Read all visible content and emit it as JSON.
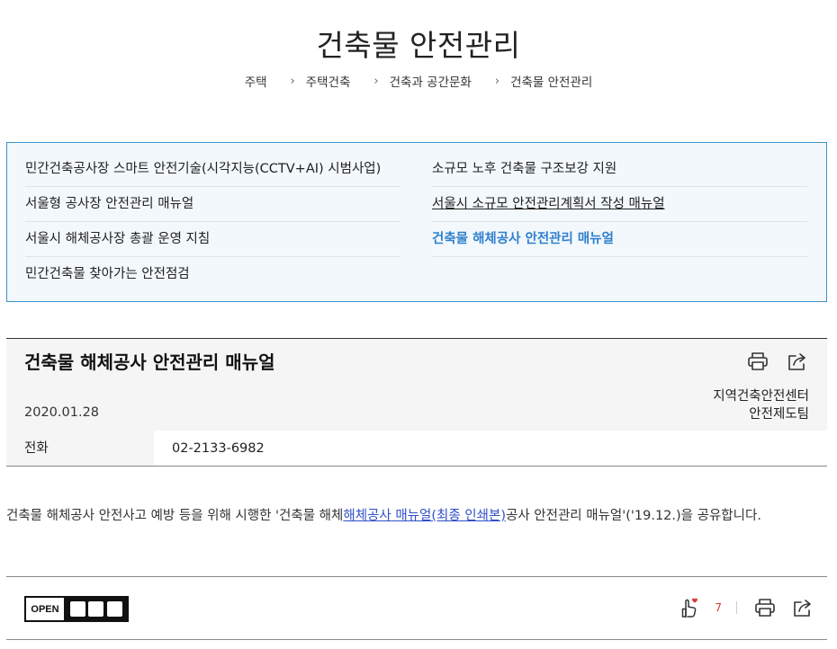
{
  "page": {
    "title": "건축물 안전관리"
  },
  "breadcrumb": [
    "주택",
    "주택건축",
    "건축과 공간문화",
    "건축물 안전관리"
  ],
  "related": {
    "left": [
      "민간건축공사장 스마트 안전기술(시각지능(CCTV+AI) 시범사업)",
      "서울형 공사장 안전관리 매뉴얼",
      "서울시 해체공사장 총괄 운영 지침",
      "민간건축물 찾아가는 안전점검"
    ],
    "right": [
      "소규모 노후 건축물 구조보강 지원",
      "서울시 소규모 안전관리계획서 작성 매뉴얼",
      "건축물 해체공사 안전관리 매뉴얼"
    ]
  },
  "article": {
    "title": "건축물 해체공사 안전관리 매뉴얼",
    "date": "2020.01.28",
    "dept_line1": "지역건축안전센터",
    "dept_line2": "안전제도팀",
    "contact_label": "전화",
    "contact_value": "02-2133-6982"
  },
  "body": {
    "text_before": "건축물 해체공사 안전사고 예방 등을 위해 시행한 '건축물 해체",
    "link": "해체공사 매뉴얼(최종 인쇄본)",
    "text_after": "공사 안전관리 매뉴얼'('19.12.)을 공유합니다."
  },
  "footer": {
    "open_label": "OPEN",
    "like_count": "7"
  },
  "colors": {
    "accent": "#2f7fcd",
    "link": "#3050c8",
    "like": "#d63a2f",
    "panel_border": "#3e93c8",
    "panel_bg": "#f2f8fc"
  },
  "icons": [
    "print-icon",
    "share-icon",
    "like-icon",
    "open-license-logo"
  ]
}
